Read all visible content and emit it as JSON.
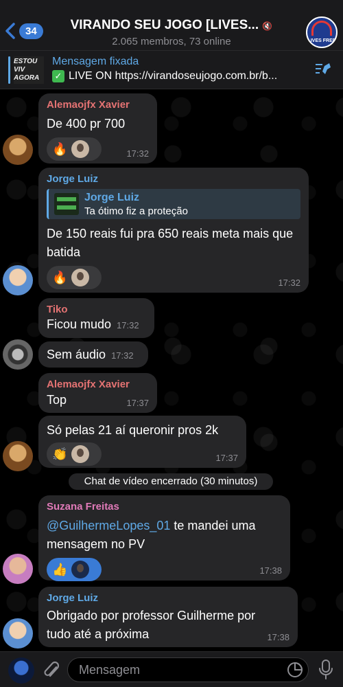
{
  "header": {
    "back_count": "34",
    "title": "VIRANDO SEU JOGO [LIVES...",
    "subtitle": "2.065 membros, 73 online",
    "avatar_label": "LIVES FREE"
  },
  "pinned": {
    "title": "Mensagem fixada",
    "thumb_text": "ESTOU VIV AGORA",
    "text": "LIVE ON https://virandoseujogo.com.br/b..."
  },
  "messages": [
    {
      "sender": "Alemaojfx Xavier",
      "sender_color": "#e57373",
      "text": "De 400 pr 700",
      "time": "17:32",
      "reaction_emoji": "🔥"
    },
    {
      "sender": "Jorge Luiz",
      "sender_color": "#5fa9e6",
      "reply_name": "Jorge Luiz",
      "reply_text": "Ta ótimo fiz a proteção",
      "text": "De 150 reais fui pra 650 reais meta mais que batida",
      "time": "17:32",
      "reaction_emoji": "🔥"
    },
    {
      "sender": "Tiko",
      "sender_color": "#e57373",
      "text": "Ficou mudo",
      "time": "17:32"
    },
    {
      "text": "Sem áudio",
      "time": "17:32"
    },
    {
      "sender": "Alemaojfx Xavier",
      "sender_color": "#e57373",
      "text": "Top",
      "time": "17:37"
    },
    {
      "text": "Só pelas 21 aí queronir pros 2k",
      "time": "17:37",
      "reaction_emoji": "👏"
    },
    {
      "system": "Chat de vídeo encerrado (30 minutos)"
    },
    {
      "sender": "Suzana Freitas",
      "sender_color": "#e07ab8",
      "mention": "@GuilhermeLopes_01",
      "text": " te mandei uma mensagem no PV",
      "time": "17:38",
      "reaction_emoji": "👍"
    },
    {
      "sender": "Jorge Luiz",
      "sender_color": "#5fa9e6",
      "text": "Obrigado por professor Guilherme por tudo até a próxima",
      "time": "17:38"
    }
  ],
  "composer": {
    "placeholder": "Mensagem"
  }
}
